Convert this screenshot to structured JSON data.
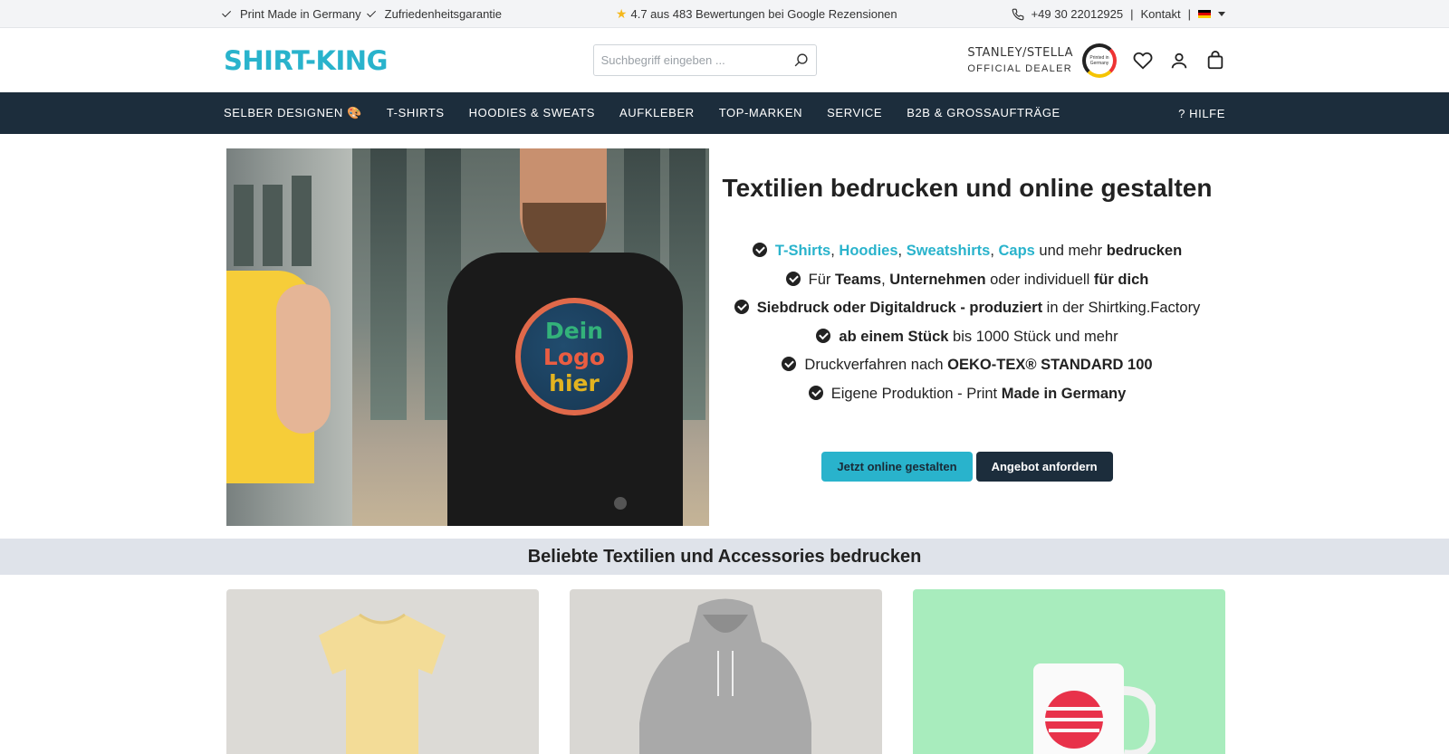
{
  "topbar": {
    "usp1": "Print Made in Germany",
    "usp2": "Zufriedenheitsgarantie",
    "rating": "4.7 aus 483 Bewertungen bei Google Rezensionen",
    "phone": "+49 30 22012925",
    "contact": "Kontakt"
  },
  "header": {
    "logo": "SHIRT-KING",
    "search_placeholder": "Suchbegriff eingeben ...",
    "dealer_brand": "STANLEY/STELLA",
    "dealer_sub": "OFFICIAL DEALER",
    "badge_text": "Printed in Germany"
  },
  "nav": {
    "items": [
      "SELBER DESIGNEN 🎨",
      "T-SHIRTS",
      "HOODIES & SWEATS",
      "AUFKLEBER",
      "TOP-MARKEN",
      "SERVICE",
      "B2B & GROSSAUFTRÄGE"
    ],
    "help": "? HILFE"
  },
  "hero": {
    "logo_lines": [
      "Dein",
      "Logo",
      "hier"
    ],
    "title": "Textilien bedrucken und online gestalten",
    "f1": {
      "a1": "T-Shirts",
      "a2": "Hoodies",
      "a3": "Sweatshirts",
      "a4": "Caps",
      "t1": " und mehr ",
      "b1": "bedrucken"
    },
    "f2": {
      "t1": "Für ",
      "b1": "Teams",
      "t2": ", ",
      "b2": "Unternehmen",
      "t3": " oder individuell ",
      "b3": "für dich"
    },
    "f3": {
      "b1": "Siebdruck oder Digitaldruck - produziert",
      "t1": " in der Shirtking.Factory"
    },
    "f4": {
      "b1": "ab einem Stück",
      "t1": " bis 1000 Stück und mehr"
    },
    "f5": {
      "t1": "Druckverfahren nach ",
      "b1": "OEKO-TEX® STANDARD 100"
    },
    "f6": {
      "t1": "Eigene Produktion - Print ",
      "b1": "Made in Germany"
    },
    "btn_primary": "Jetzt online gestalten",
    "btn_secondary": "Angebot anfordern"
  },
  "section": {
    "title": "Beliebte Textilien und Accessories bedrucken"
  },
  "colors": {
    "accent": "#29b3cc",
    "nav_bg": "#1c2d3c"
  }
}
